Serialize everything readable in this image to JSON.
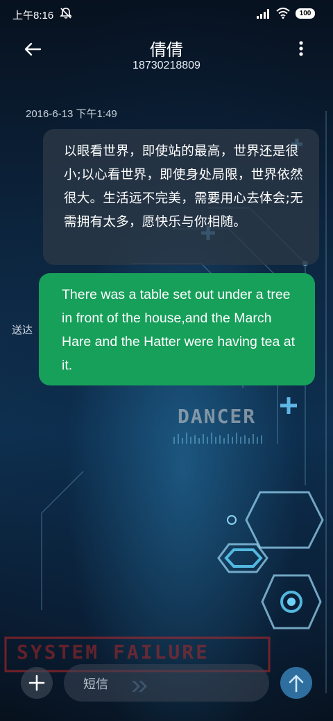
{
  "status_bar": {
    "time": "上午8:16",
    "battery": "100",
    "icons": [
      "mute-icon",
      "signal-icon",
      "wifi-icon",
      "battery-icon"
    ]
  },
  "header": {
    "contact_name": "倩倩",
    "contact_number": "18730218809",
    "icons": [
      "back-arrow-icon",
      "more-vertical-icon"
    ]
  },
  "conversation": {
    "timestamp": "2016-6-13 下午1:49",
    "incoming_message": "以眼看世界，即使站的最高，世界还是很小;以心看世界，即使身处局限，世界依然很大。生活远不完美，需要用心去体会;无需拥有太多，愿快乐与你相随。",
    "outgoing_message": "There was a table set out under a tree in front of the house,and the March Hare and the Hatter were having tea at it.",
    "sent_status": "送达",
    "outgoing_bubble_color": "#17a05a"
  },
  "composer": {
    "placeholder": "短信",
    "icons": [
      "plus-icon",
      "send-arrow-icon"
    ]
  },
  "wallpaper": {
    "texts": [
      "DANCER",
      "SYSTEM FAILURE"
    ]
  }
}
